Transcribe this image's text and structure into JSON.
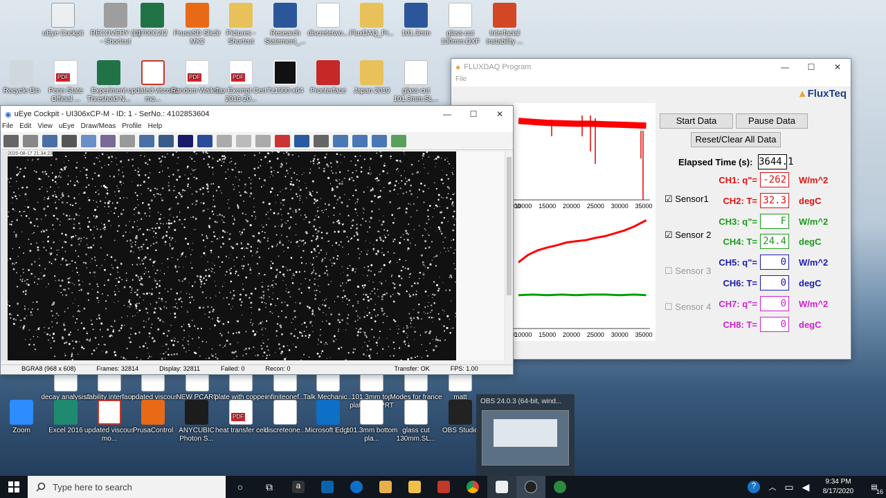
{
  "desktop_icons": [
    {
      "label": "uEye Cockpit",
      "glyph": "g-cam"
    },
    {
      "label": "RECOVERY (D) - Shortcut",
      "glyph": "g-drive"
    },
    {
      "label": "1700C2I2",
      "glyph": "g-excel"
    },
    {
      "label": "PrusaSD Slic3r MK2",
      "glyph": "g-orange"
    },
    {
      "label": "Pictures - Shortcut",
      "glyph": "g-folder"
    },
    {
      "label": "Research Statement_...",
      "glyph": "g-word"
    },
    {
      "label": "discretetwo...",
      "glyph": "g-doc"
    },
    {
      "label": "FluxDAQ_Pr...",
      "glyph": "g-folder"
    },
    {
      "label": "101.3mm",
      "glyph": "g-word"
    },
    {
      "label": "glass cut 130mm.DXF",
      "glyph": "g-doc"
    },
    {
      "label": "Interfacial Instability ...",
      "glyph": "g-ppt"
    },
    {
      "label": "Recycle Bin",
      "glyph": "g-bin"
    },
    {
      "label": "Penn State Official ...",
      "glyph": "g-pdf"
    },
    {
      "label": "Experiment Threshold N...",
      "glyph": "g-excel"
    },
    {
      "label": "updated viscous mo...",
      "glyph": "g-gear"
    },
    {
      "label": "Random Walks...",
      "glyph": "g-pdf"
    },
    {
      "label": "Tax Exempt Cert 2016-20...",
      "glyph": "g-pdf"
    },
    {
      "label": "7z1900-x64",
      "glyph": "g-black"
    },
    {
      "label": "Pronterface",
      "glyph": "g-red"
    },
    {
      "label": "Japan 2019",
      "glyph": "g-folder"
    },
    {
      "label": "glass cut 101.3mm.SL...",
      "glyph": "g-doc"
    },
    {
      "label": "decay analysis2",
      "glyph": "g-doc"
    },
    {
      "label": "stability interface stuff",
      "glyph": "g-doc"
    },
    {
      "label": "updated viscous mo...",
      "glyph": "g-doc"
    },
    {
      "label": "NEW PCARD FORM",
      "glyph": "g-doc"
    },
    {
      "label": "plate with copper disc",
      "glyph": "g-doc"
    },
    {
      "label": "infiniteonef...",
      "glyph": "g-doc"
    },
    {
      "label": "Talk Mechanic...",
      "glyph": "g-doc"
    },
    {
      "label": "101.3mm top plate.SLDPRT",
      "glyph": "g-doc"
    },
    {
      "label": "Modes for france",
      "glyph": "g-doc"
    },
    {
      "label": "matt",
      "glyph": "g-doc"
    },
    {
      "label": "Zoom",
      "glyph": "g-zoom"
    },
    {
      "label": "Excel 2016",
      "glyph": "g-excel16"
    },
    {
      "label": "updated viscous mo...",
      "glyph": "g-gear"
    },
    {
      "label": "PrusaControl",
      "glyph": "g-orange"
    },
    {
      "label": "ANYCUBIC Photon S...",
      "glyph": "g-phot"
    },
    {
      "label": "heat transfer cell",
      "glyph": "g-pdf"
    },
    {
      "label": "discreteone...",
      "glyph": "g-doc"
    },
    {
      "label": "Microsoft Edge",
      "glyph": "g-edge"
    },
    {
      "label": "101.3mm bottom pla...",
      "glyph": "g-doc"
    },
    {
      "label": "glass cut 130mm.SL...",
      "glyph": "g-doc"
    },
    {
      "label": "OBS Studio",
      "glyph": "g-dark"
    }
  ],
  "flux": {
    "title": "FLUXDAQ Program",
    "menu_file": "File",
    "logo": "FluxTeq",
    "start_label": "Start Data",
    "pause_label": "Pause Data",
    "reset_label": "Reset/Clear All Data",
    "elapsed_label": "Elapsed Time (s):",
    "elapsed_value": "3644.1",
    "sensors": [
      {
        "label": "Sensor1",
        "checked": true
      },
      {
        "label": "Sensor 2",
        "checked": true
      },
      {
        "label": "Sensor 3",
        "checked": false
      },
      {
        "label": "Sensor 4",
        "checked": false
      }
    ],
    "channels": [
      {
        "label": "CH1: q\"=",
        "value": "-262",
        "unit": "W/m^2",
        "color": "#e01010"
      },
      {
        "label": "CH2: T=",
        "value": "32.3",
        "unit": "degC",
        "color": "#e01010"
      },
      {
        "label": "CH3: q\"=",
        "value": "F",
        "unit": "W/m^2",
        "color": "#1a9a1a"
      },
      {
        "label": "CH4: T=",
        "value": "24.4",
        "unit": "degC",
        "color": "#1a9a1a"
      },
      {
        "label": "CH5: q\"=",
        "value": "0",
        "unit": "W/m^2",
        "color": "#1a1ab0"
      },
      {
        "label": "CH6: T=",
        "value": "0",
        "unit": "degC",
        "color": "#1a1ab0"
      },
      {
        "label": "CH7: q\"=",
        "value": "0",
        "unit": "W/m^2",
        "color": "#d020d0"
      },
      {
        "label": "CH8: T=",
        "value": "0",
        "unit": "degC",
        "color": "#d020d0"
      }
    ]
  },
  "chart_data": [
    {
      "type": "line",
      "title": "",
      "x_ticks": [
        "10000",
        "15000",
        "20000",
        "25000",
        "30000",
        "35000"
      ],
      "x_tick_partial": "00",
      "series": [
        {
          "color": "#ff0000",
          "x": [
            9000,
            12000,
            15000,
            18000,
            21000,
            24000,
            27000,
            30000,
            33000,
            35500
          ],
          "y": [
            0.62,
            0.6,
            0.58,
            0.57,
            0.56,
            0.56,
            0.55,
            0.54,
            0.53,
            0.52
          ]
        }
      ]
    },
    {
      "type": "line",
      "title": "",
      "x_ticks": [
        "10000",
        "15000",
        "20000",
        "25000",
        "30000",
        "35000"
      ],
      "x_tick_partial": "0",
      "series": [
        {
          "color": "#ff0000",
          "x": [
            9000,
            11000,
            13000,
            15000,
            17000,
            19000,
            21000,
            23000,
            25000,
            27000,
            29000,
            31000,
            33000,
            35500
          ],
          "y": [
            0.12,
            0.25,
            0.33,
            0.38,
            0.42,
            0.47,
            0.49,
            0.51,
            0.55,
            0.58,
            0.63,
            0.68,
            0.75,
            0.86
          ]
        },
        {
          "color": "#00a000",
          "x": [
            9000,
            12000,
            15000,
            18000,
            21000,
            24000,
            27000,
            30000,
            33000,
            35500
          ],
          "y": [
            -0.46,
            -0.45,
            -0.46,
            -0.45,
            -0.46,
            -0.45,
            -0.45,
            -0.46,
            -0.45,
            -0.46
          ]
        }
      ]
    }
  ],
  "ueye": {
    "title": "uEye Cockpit - UI306xCP-M - ID: 1 - SerNo.: 4102853604",
    "menu": [
      "File",
      "Edit",
      "View",
      "uEye",
      "Draw/Meas",
      "Profile",
      "Help"
    ],
    "timestamp": "2020-08-17 21:34:23",
    "status": [
      "BGRA8 (968 x 608)",
      "Frames: 32814",
      "Display: 32811",
      "Failed: 0",
      "Recon: 0",
      "Transfer: OK",
      "FPS: 1.00"
    ]
  },
  "obs_popup": {
    "title": "OBS 24.0.3 (64-bit, wind..."
  },
  "taskbar": {
    "search_placeholder": "Type here to search",
    "time": "9:34 PM",
    "date": "8/17/2020",
    "notifications": "16"
  }
}
